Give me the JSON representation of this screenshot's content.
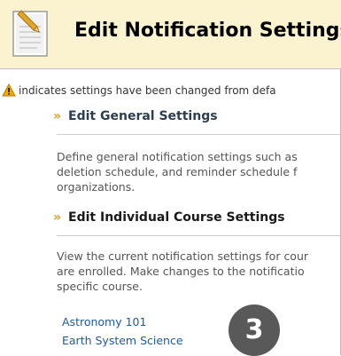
{
  "header": {
    "title": "Edit Notification Settings"
  },
  "notice": {
    "text": "indicates settings have been changed from defa"
  },
  "sections": {
    "general": {
      "title": "Edit General Settings",
      "desc_lines": [
        "Define general notification settings such as",
        "deletion schedule, and reminder schedule f",
        "organizations."
      ]
    },
    "individual": {
      "title": "Edit Individual Course Settings",
      "desc_lines": [
        "View the current notification settings for cour",
        "are enrolled. Make changes to the notificatio",
        "specific course."
      ],
      "courses": [
        "Astronomy 101",
        "Earth System Science"
      ]
    }
  },
  "badge": {
    "number": "3"
  },
  "icons": {
    "header": "document-icon",
    "notice": "warning-icon",
    "chevron": "chevron-right-icon"
  },
  "colors": {
    "header_bg": "#fbf3cf",
    "chevron": "#d9a21b",
    "link": "#1e5aa8",
    "badge_bg": "#595959",
    "warning": "#f2a900"
  }
}
